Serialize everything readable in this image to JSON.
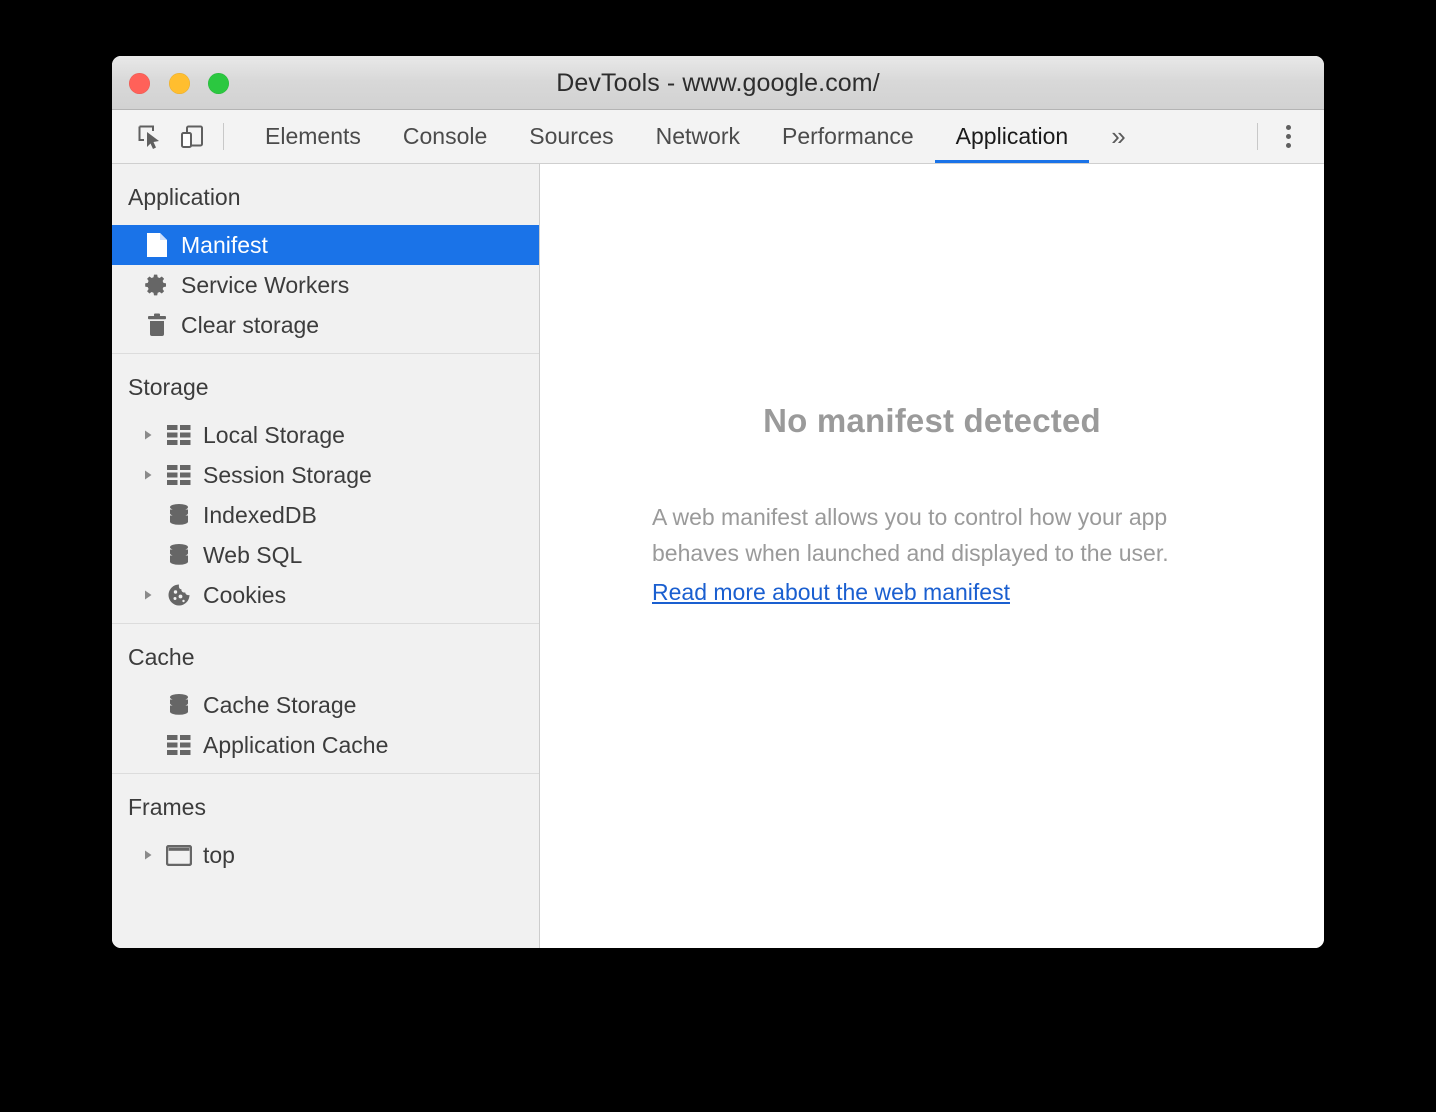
{
  "window": {
    "title": "DevTools - www.google.com/",
    "traffic_lights": [
      {
        "name": "close",
        "color": "#ff6159"
      },
      {
        "name": "minimize",
        "color": "#ffbe2f"
      },
      {
        "name": "maximize",
        "color": "#2bc840"
      }
    ]
  },
  "toolbar": {
    "inspect_icon": "inspect-element-icon",
    "device_icon": "device-toolbar-icon",
    "more_tabs_label": "»",
    "menu_icon": "kebab-menu-icon"
  },
  "tabs": [
    {
      "label": "Elements",
      "active": false
    },
    {
      "label": "Console",
      "active": false
    },
    {
      "label": "Sources",
      "active": false
    },
    {
      "label": "Network",
      "active": false
    },
    {
      "label": "Performance",
      "active": false
    },
    {
      "label": "Application",
      "active": true
    }
  ],
  "sidebar": {
    "sections": [
      {
        "title": "Application",
        "items": [
          {
            "label": "Manifest",
            "icon": "document-icon",
            "expandable": false,
            "selected": true
          },
          {
            "label": "Service Workers",
            "icon": "gear-icon",
            "expandable": false,
            "selected": false
          },
          {
            "label": "Clear storage",
            "icon": "trash-icon",
            "expandable": false,
            "selected": false
          }
        ]
      },
      {
        "title": "Storage",
        "items": [
          {
            "label": "Local Storage",
            "icon": "table-icon",
            "expandable": true,
            "selected": false
          },
          {
            "label": "Session Storage",
            "icon": "table-icon",
            "expandable": true,
            "selected": false
          },
          {
            "label": "IndexedDB",
            "icon": "database-icon",
            "expandable": false,
            "selected": false
          },
          {
            "label": "Web SQL",
            "icon": "database-icon",
            "expandable": false,
            "selected": false
          },
          {
            "label": "Cookies",
            "icon": "cookie-icon",
            "expandable": true,
            "selected": false
          }
        ]
      },
      {
        "title": "Cache",
        "items": [
          {
            "label": "Cache Storage",
            "icon": "database-icon",
            "expandable": false,
            "selected": false
          },
          {
            "label": "Application Cache",
            "icon": "table-icon",
            "expandable": false,
            "selected": false
          }
        ]
      },
      {
        "title": "Frames",
        "items": [
          {
            "label": "top",
            "icon": "frame-icon",
            "expandable": true,
            "selected": false
          }
        ]
      }
    ]
  },
  "main": {
    "empty_title": "No manifest detected",
    "empty_description": "A web manifest allows you to control how your app behaves when launched and displayed to the user.",
    "empty_link": "Read more about the web manifest"
  },
  "colors": {
    "accent": "#1a73e8",
    "link": "#1a5fd0",
    "sidebar_bg": "#f1f1f1",
    "muted_text": "#9a9a9a"
  }
}
